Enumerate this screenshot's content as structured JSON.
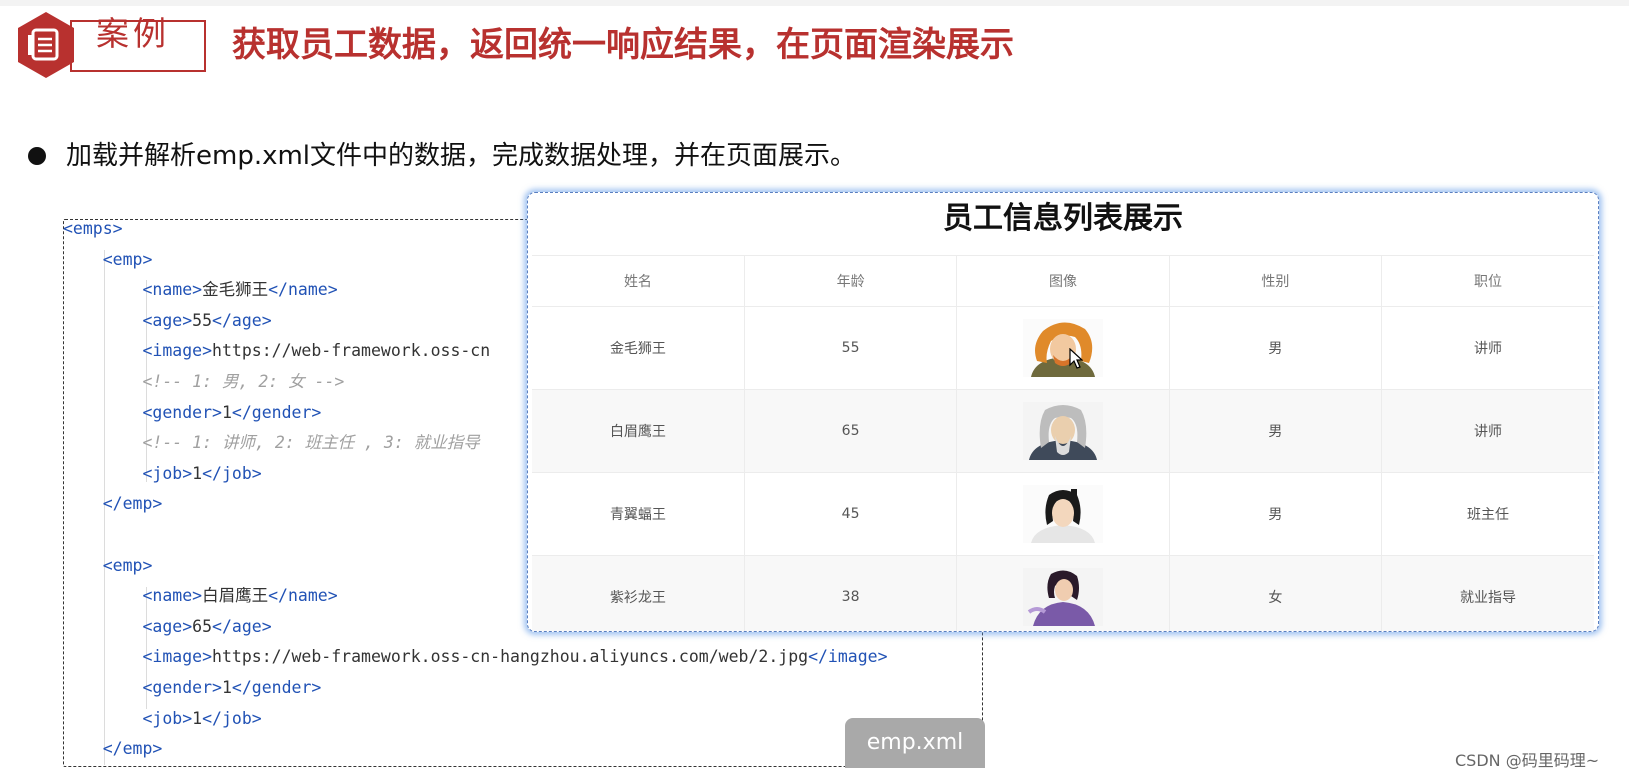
{
  "header": {
    "badge_label": "案例",
    "title": "获取员工数据，返回统一响应结果，在页面渲染展示"
  },
  "bullet": {
    "text": "加载并解析emp.xml文件中的数据，完成数据处理，并在页面展示。"
  },
  "code": {
    "lines": [
      {
        "indent": 0,
        "parts": [
          [
            "tag",
            "<emps>"
          ]
        ]
      },
      {
        "indent": 1,
        "parts": [
          [
            "tag",
            "<emp>"
          ]
        ]
      },
      {
        "indent": 2,
        "parts": [
          [
            "tag",
            "<name>"
          ],
          [
            "txt",
            "金毛狮王"
          ],
          [
            "tag",
            "</name>"
          ]
        ]
      },
      {
        "indent": 2,
        "parts": [
          [
            "tag",
            "<age>"
          ],
          [
            "txt",
            "55"
          ],
          [
            "tag",
            "</age>"
          ]
        ]
      },
      {
        "indent": 2,
        "parts": [
          [
            "tag",
            "<image>"
          ],
          [
            "txt",
            "https://web-framework.oss-cn"
          ]
        ]
      },
      {
        "indent": 2,
        "parts": [
          [
            "cm",
            "<!-- 1: 男, 2: 女 -->"
          ]
        ]
      },
      {
        "indent": 2,
        "parts": [
          [
            "tag",
            "<gender>"
          ],
          [
            "txt",
            "1"
          ],
          [
            "tag",
            "</gender>"
          ]
        ]
      },
      {
        "indent": 2,
        "parts": [
          [
            "cm",
            "<!-- 1: 讲师, 2: 班主任 , 3: 就业指导"
          ]
        ]
      },
      {
        "indent": 2,
        "parts": [
          [
            "tag",
            "<job>"
          ],
          [
            "txt",
            "1"
          ],
          [
            "tag",
            "</job>"
          ]
        ]
      },
      {
        "indent": 1,
        "parts": [
          [
            "tag",
            "</emp>"
          ]
        ]
      },
      {
        "indent": 0,
        "parts": []
      },
      {
        "indent": 1,
        "parts": [
          [
            "tag",
            "<emp>"
          ]
        ]
      },
      {
        "indent": 2,
        "parts": [
          [
            "tag",
            "<name>"
          ],
          [
            "txt",
            "白眉鹰王"
          ],
          [
            "tag",
            "</name>"
          ]
        ]
      },
      {
        "indent": 2,
        "parts": [
          [
            "tag",
            "<age>"
          ],
          [
            "txt",
            "65"
          ],
          [
            "tag",
            "</age>"
          ]
        ]
      },
      {
        "indent": 2,
        "parts": [
          [
            "tag",
            "<image>"
          ],
          [
            "txt",
            "https://web-framework.oss-cn-hangzhou.aliyuncs.com/web/2.jpg"
          ],
          [
            "tag",
            "</image>"
          ]
        ]
      },
      {
        "indent": 2,
        "parts": [
          [
            "tag",
            "<gender>"
          ],
          [
            "txt",
            "1"
          ],
          [
            "tag",
            "</gender>"
          ]
        ]
      },
      {
        "indent": 2,
        "parts": [
          [
            "tag",
            "<job>"
          ],
          [
            "txt",
            "1"
          ],
          [
            "tag",
            "</job>"
          ]
        ]
      },
      {
        "indent": 1,
        "parts": [
          [
            "tag",
            "</emp>"
          ]
        ]
      }
    ]
  },
  "file_label": "emp.xml",
  "table": {
    "title": "员工信息列表展示",
    "headers": [
      "姓名",
      "年龄",
      "图像",
      "性别",
      "职位"
    ],
    "rows": [
      {
        "name": "金毛狮王",
        "age": "55",
        "avatar": "golden-lion-king-avatar",
        "gender": "男",
        "job": "讲师"
      },
      {
        "name": "白眉鹰王",
        "age": "65",
        "avatar": "white-brow-eagle-king-avatar",
        "gender": "男",
        "job": "讲师"
      },
      {
        "name": "青翼蝠王",
        "age": "45",
        "avatar": "green-wing-bat-king-avatar",
        "gender": "男",
        "job": "班主任"
      },
      {
        "name": "紫衫龙王",
        "age": "38",
        "avatar": "purple-robe-dragon-king-avatar",
        "gender": "女",
        "job": "就业指导"
      }
    ]
  },
  "watermark": "CSDN @码里码理~",
  "colors": {
    "accent": "#b8312f",
    "tag": "#2152b5",
    "comment": "#a0a0a0",
    "glow": "#5a96e6"
  }
}
